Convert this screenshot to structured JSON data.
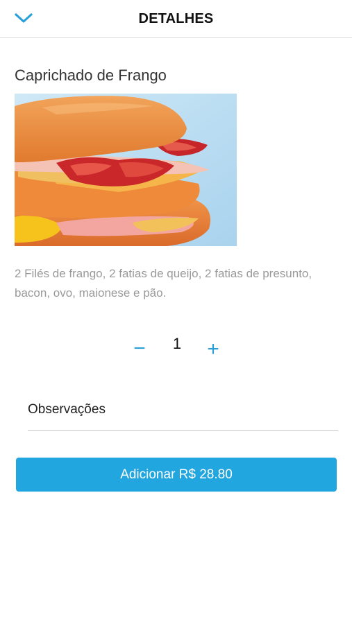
{
  "header": {
    "title": "DETALHES",
    "back_icon": "chevron-down-icon"
  },
  "product": {
    "name": "Caprichado de Frango",
    "description": "2 Filés de frango, 2 fatias de queijo, 2 fatias de presunto, bacon, ovo, maionese e pão."
  },
  "quantity": {
    "minus_label": "−",
    "value": "1",
    "plus_label": "+"
  },
  "observations": {
    "label": "Observações"
  },
  "add_button": {
    "label": "Adicionar R$ 28.80"
  },
  "colors": {
    "accent": "#22a6e0",
    "icon_blue": "#2aa0da"
  }
}
